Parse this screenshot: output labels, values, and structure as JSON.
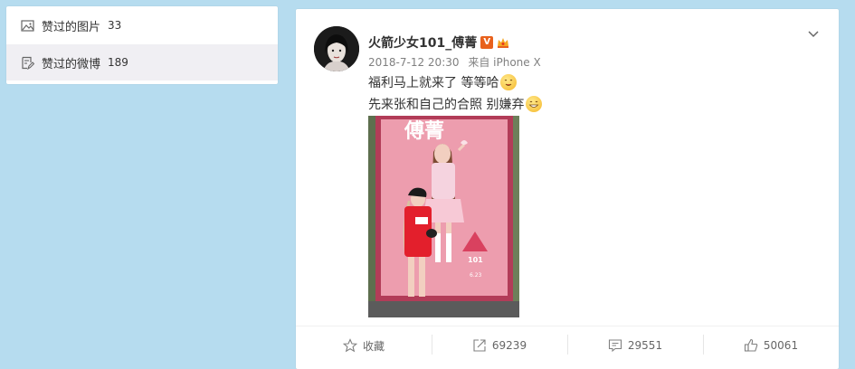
{
  "sidebar": {
    "items": [
      {
        "label": "赞过的图片",
        "count": "33",
        "icon": "image-icon"
      },
      {
        "label": "赞过的微博",
        "count": "189",
        "icon": "edit-note-icon"
      }
    ]
  },
  "post": {
    "username": "火箭少女101_傅菁",
    "verified_badge": "V",
    "date": "2018-7-12 20:30",
    "source": "来自 iPhone X",
    "line1": "福利马上就来了 等等哈",
    "line2": "先来张和自己的合照  别嫌弃",
    "poster_text": "傅菁",
    "poster_date": "6.23",
    "poster_logo": "101"
  },
  "actions": {
    "favorite": "收藏",
    "repost": "69239",
    "comment": "29551",
    "like": "50061"
  },
  "colors": {
    "background": "#b6dcef",
    "selected_item": "#f0eff3",
    "badge": "#e8611c"
  }
}
